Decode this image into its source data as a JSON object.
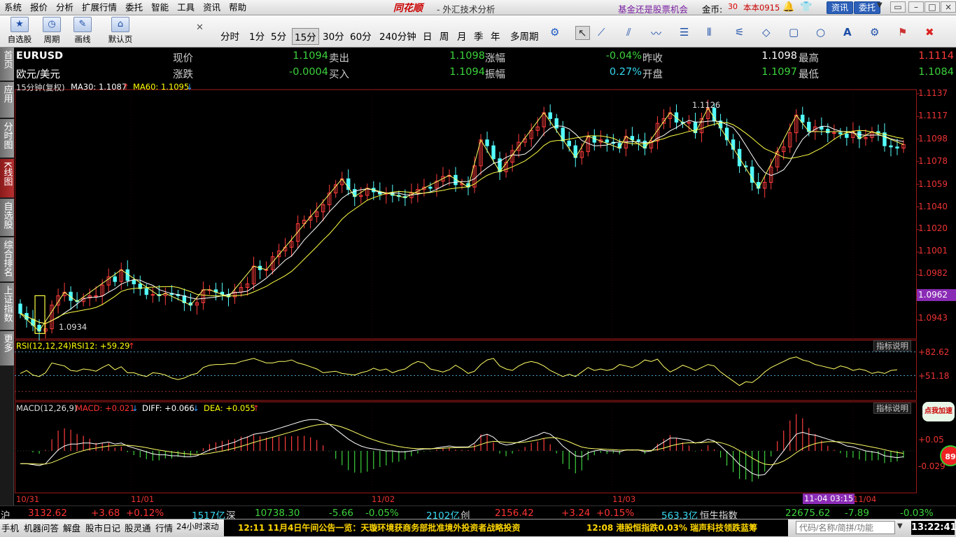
{
  "menu": [
    "系统",
    "报价",
    "分析",
    "扩展行情",
    "委托",
    "智能",
    "工具",
    "资讯",
    "帮助"
  ],
  "app_logo": "同花顺",
  "window_title": "- 外汇技术分析",
  "promo": "基金还是股票机会",
  "gold_label": "金币:",
  "gold_value": "30",
  "user_name": "本本0915",
  "news_button": "资讯",
  "trade_button": "委托",
  "tools": [
    {
      "icon": "★",
      "label": "自选股"
    },
    {
      "icon": "◷",
      "label": "周期"
    },
    {
      "icon": "✎",
      "label": "画线"
    },
    {
      "icon": "⌂",
      "label": "默认页"
    }
  ],
  "periods": [
    "分时",
    "1分",
    "5分",
    "15分",
    "30分",
    "60分",
    "240分钟",
    "日",
    "周",
    "月",
    "季",
    "年",
    "多周期"
  ],
  "active_period": "15分",
  "quote": {
    "code": "EURUSD",
    "name": "欧元/美元",
    "labels": {
      "price": "现价",
      "change": "涨跌",
      "sell": "卖出",
      "buy": "买入",
      "pct": "涨幅",
      "amp": "振幅",
      "prev": "昨收",
      "open": "开盘",
      "high": "最高",
      "low": "最低"
    },
    "price": "1.1094",
    "change": "-0.0004",
    "sell": "1.1098",
    "buy": "1.1094",
    "pct": "-0.04%",
    "amp": "0.27%",
    "prev": "1.1098",
    "open": "1.1097",
    "high": "1.1114",
    "low": "1.1084"
  },
  "sidebar_tabs": [
    "首页",
    "应用",
    "分时图",
    "K线图",
    "自选股",
    "综合排名",
    "上证指数",
    "更多"
  ],
  "active_tab": "K线图",
  "kline_header": {
    "period": "15分钟(复权)",
    "ma30": "MA30: 1.1087",
    "ma60": "MA60: 1.1095"
  },
  "price_axis": [
    "1.1137",
    "1.1117",
    "1.1098",
    "1.1078",
    "1.1059",
    "1.1040",
    "1.1020",
    "1.1001",
    "1.0982",
    "1.0962",
    "1.0943"
  ],
  "current_price_tag": "1.0962",
  "annotations": {
    "high": "1.1126",
    "low": "1.0934"
  },
  "rsi_header": "RSI(12,12,24)",
  "rsi12": "RSI12: +59.29",
  "rsi_axis": [
    "+82.62",
    "+51.18"
  ],
  "macd_header": "MACD(12,26,9)",
  "macd": "MACD: +0.021",
  "diff": "DIFF: +0.066",
  "dea": "DEA: +0.055",
  "macd_axis": [
    "+0.05",
    "-0.029"
  ],
  "indicator_help": "指标说明",
  "dates": [
    "10/31",
    "11/01",
    "11/02",
    "11/03",
    "11/04"
  ],
  "cursor_time": "11-04 03:15",
  "ads": {
    "add": "点我加速",
    "score": "89"
  },
  "chart_data": {
    "type": "candlestick",
    "close": [
      1.0951,
      1.0946,
      1.0941,
      1.0936,
      1.0938,
      1.0958,
      1.0966,
      1.0969,
      1.0962,
      1.0961,
      1.0964,
      1.0966,
      1.0966,
      1.0975,
      1.0982,
      1.0978,
      1.0988,
      1.0979,
      1.0976,
      1.0972,
      1.0967,
      1.0967,
      1.0966,
      1.0968,
      1.0967,
      1.0966,
      1.096,
      1.0958,
      1.096,
      1.0971,
      1.0971,
      1.0969,
      1.0967,
      1.0965,
      1.0969,
      1.0973,
      1.0976,
      1.0991,
      1.0988,
      1.0988,
      1.0999,
      1.1004,
      1.1007,
      1.1012,
      1.1027,
      1.103,
      1.1033,
      1.1037,
      1.1043,
      1.1053,
      1.106,
      1.1065,
      1.1056,
      1.105,
      1.1051,
      1.1057,
      1.1054,
      1.1052,
      1.1053,
      1.1051,
      1.105,
      1.1049,
      1.1053,
      1.1056,
      1.1058,
      1.1057,
      1.1063,
      1.1067,
      1.1068,
      1.106,
      1.1061,
      1.1058,
      1.1076,
      1.1098,
      1.1093,
      1.1082,
      1.1071,
      1.1079,
      1.1089,
      1.1096,
      1.1099,
      1.1106,
      1.1109,
      1.1121,
      1.1116,
      1.1108,
      1.1097,
      1.1093,
      1.1083,
      1.1088,
      1.1101,
      1.1096,
      1.1098,
      1.1096,
      1.1095,
      1.1091,
      1.1101,
      1.1098,
      1.1097,
      1.1091,
      1.1097,
      1.1112,
      1.1116,
      1.1121,
      1.1113,
      1.1112,
      1.1113,
      1.1104,
      1.1116,
      1.1125,
      1.1114,
      1.1108,
      1.1098,
      1.109,
      1.1076,
      1.1075,
      1.1062,
      1.1057,
      1.1062,
      1.1075,
      1.1088,
      1.1092,
      1.1104,
      1.1119,
      1.1113,
      1.1105,
      1.1109,
      1.1107,
      1.1104,
      1.1104,
      1.1103,
      1.11,
      1.1105,
      1.1099,
      1.11,
      1.1105,
      1.1104,
      1.1093,
      1.1092,
      1.1091,
      1.1094
    ],
    "rsi12": [
      54,
      58,
      52,
      50,
      55,
      68,
      66,
      64,
      58,
      57,
      60,
      59,
      57,
      62,
      66,
      59,
      63,
      55,
      55,
      52,
      50,
      55,
      54,
      52,
      48,
      46,
      48,
      52,
      54,
      62,
      65,
      66,
      66,
      67,
      67,
      70,
      72,
      74,
      71,
      68,
      68,
      70,
      70,
      72,
      68,
      66,
      63,
      60,
      55,
      56,
      57,
      54,
      53,
      52,
      55,
      57,
      61,
      58,
      60,
      55,
      58,
      60,
      66,
      70,
      68,
      60,
      58,
      56,
      59,
      65,
      60,
      54,
      57,
      66,
      72,
      74,
      64,
      60,
      58,
      64,
      68,
      70,
      68,
      64,
      58,
      54,
      50,
      53,
      50,
      56,
      62,
      58,
      60,
      58,
      60,
      66,
      64,
      62,
      66,
      72,
      70,
      73,
      63,
      56,
      60,
      65,
      62,
      58,
      62,
      66,
      64,
      56,
      50,
      44,
      38,
      43,
      42,
      48,
      56,
      62,
      66,
      70,
      74,
      76,
      72,
      70,
      66,
      64,
      62,
      60,
      64,
      62,
      58,
      60,
      58,
      54,
      56,
      54,
      58,
      59
    ],
    "macd_diff": [
      -0.0013,
      -0.0013,
      -0.0014,
      -0.0015,
      -0.0013,
      -0.0006,
      0.0001,
      0.0005,
      0.0007,
      0.0007,
      0.0008,
      0.0008,
      0.0007,
      0.0008,
      0.0009,
      0.0007,
      0.0008,
      0.0005,
      0.0003,
      0.0001,
      -0.0001,
      -0.0003,
      -0.0004,
      -0.0004,
      -0.0005,
      -0.0005,
      -0.0006,
      -0.0006,
      -0.0005,
      -0.0002,
      0.0001,
      0.0003,
      0.0005,
      0.0007,
      0.0009,
      0.0012,
      0.0014,
      0.0017,
      0.0018,
      0.0019,
      0.0021,
      0.0023,
      0.0025,
      0.0027,
      0.0029,
      0.0031,
      0.0032,
      0.0032,
      0.003,
      0.0027,
      0.0022,
      0.0017,
      0.0012,
      0.0008,
      0.0005,
      0.0003,
      0.0002,
      0.0001,
      0.0,
      0.0,
      -0.0001,
      -0.0001,
      0.0,
      0.0001,
      0.0002,
      0.0002,
      0.0003,
      0.0004,
      0.0005,
      0.0004,
      0.0004,
      0.0004,
      0.0008,
      0.0015,
      0.0017,
      0.0014,
      0.0008,
      0.0006,
      0.0007,
      0.0009,
      0.0011,
      0.0014,
      0.0016,
      0.0019,
      0.0017,
      0.0012,
      0.0005,
      0.0,
      -0.0005,
      -0.0006,
      -0.0002,
      0.0,
      0.0001,
      0.0,
      0.0,
      -0.0001,
      0.0001,
      0.0001,
      0.0001,
      -0.0001,
      0.0,
      0.0005,
      0.0009,
      0.0013,
      0.0013,
      0.0012,
      0.0011,
      0.0008,
      0.0009,
      0.0012,
      0.001,
      0.0005,
      -0.0001,
      -0.0007,
      -0.0014,
      -0.0018,
      -0.0023,
      -0.0025,
      -0.0024,
      -0.0017,
      -0.0008,
      0.0,
      0.0009,
      0.0017,
      0.0019,
      0.0017,
      0.0016,
      0.0014,
      0.0012,
      0.001,
      0.0008,
      0.0005,
      0.0004,
      0.0002,
      0.0,
      -0.0001,
      -0.0002,
      -0.0005,
      -0.0006,
      -0.0007,
      -0.0006
    ],
    "y_range": [
      1.0933,
      1.1137
    ]
  },
  "status_bar": {
    "sh_label": "沪",
    "sh_value": "3132.62",
    "sh_change": "+3.68",
    "sh_pct": "+0.12%",
    "sh_amount": "1517亿",
    "sz_label": "深",
    "sz_value": "10738.30",
    "sz_change": "-5.66",
    "sz_pct": "-0.05%",
    "sz_amount": "2102亿",
    "cy_label": "创",
    "cy_value": "2156.42",
    "cy_change": "+3.24",
    "cy_pct": "+0.15%",
    "cy_amount": "563.3亿",
    "hs_label": "恒生指数",
    "hs_value": "22675.62",
    "hs_change": "-7.89",
    "hs_pct": "-0.03%"
  },
  "bottom_bar": {
    "items": [
      "手机",
      "机器问答",
      "解盘",
      "股市日记",
      "股灵通",
      "行情",
      "24小时滚动"
    ],
    "news1": "12:11  11月4日午间公告一览：天璇环境获商务部批准境外投资者战略投资",
    "news2": "12:08  港股恒指跌0.03%  瑞声科技领跌蓝筹",
    "search_placeholder": "代码/名称/简拼/功能",
    "clock": "13:22:41"
  }
}
